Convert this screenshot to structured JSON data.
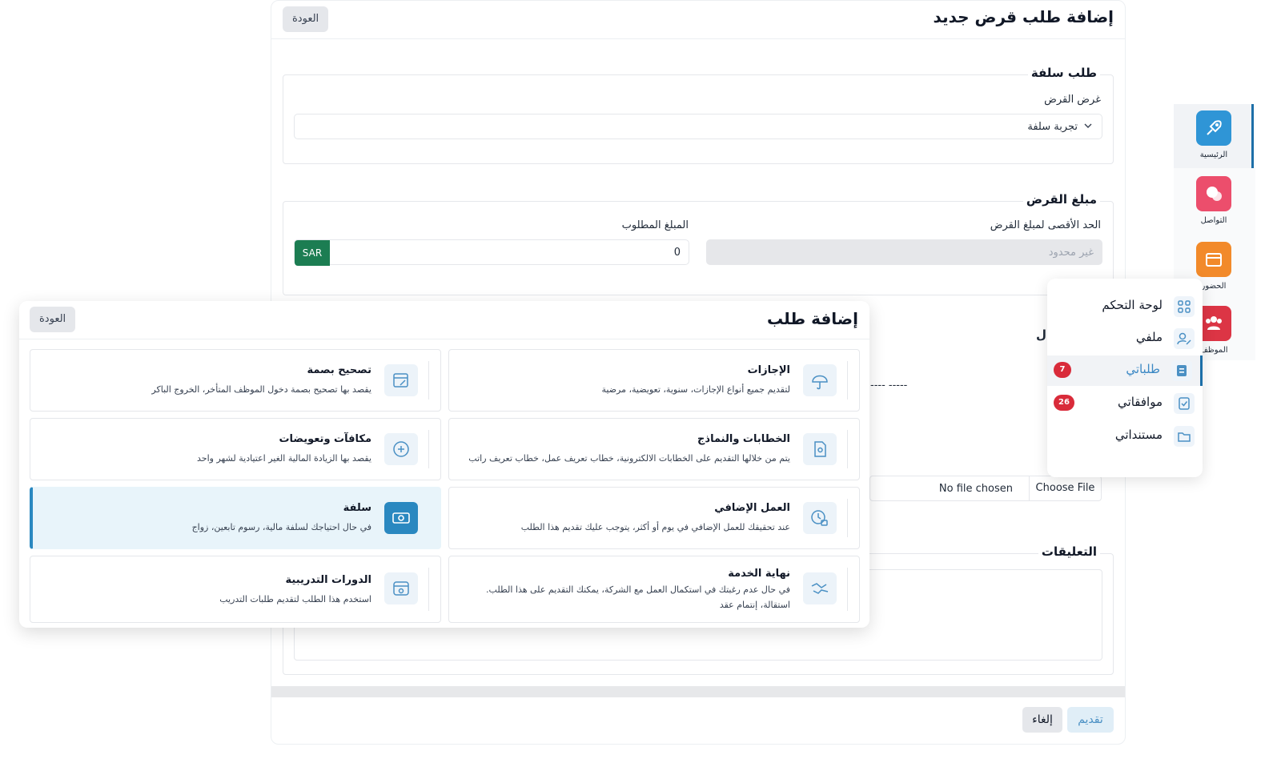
{
  "form": {
    "title": "إضافة طلب قرض جديد",
    "back_label": "العودة",
    "loan_request_legend": "طلب سلفة",
    "purpose_label": "غرض القرض",
    "purpose_value": "تجربة سلفة",
    "amount_legend": "مبلغ القرض",
    "max_amount_label": "الحد الأقصى لمبلغ القرض",
    "max_amount_placeholder": "غير محدود",
    "requested_amount_label": "المبلغ المطلوب",
    "requested_amount_value": "0",
    "currency": "SAR",
    "dashes": "---- -----",
    "partial_legend": "ل",
    "file_name": "No file chosen",
    "choose_file_label": "Choose File",
    "comments_legend": "التعليقات",
    "submit_label": "تقديم",
    "cancel_label": "إلغاء"
  },
  "sidebar": {
    "items": [
      {
        "label": "الرئيسية",
        "icon": "rocket-icon",
        "color": "#2f95d6"
      },
      {
        "label": "التواصل",
        "icon": "chat-icon",
        "color": "#ec4e6c"
      },
      {
        "label": "الحضور",
        "icon": "calendar-icon",
        "color": "#f28a2a"
      },
      {
        "label": "الموظف",
        "icon": "users-icon",
        "color": "#dc3545"
      }
    ]
  },
  "menu": {
    "items": [
      {
        "label": "لوحة التحكم",
        "icon": "grid-icon",
        "badge": ""
      },
      {
        "label": "ملفي",
        "icon": "user-edit-icon",
        "badge": ""
      },
      {
        "label": "طلباتي",
        "icon": "requests-icon",
        "badge": "7"
      },
      {
        "label": "موافقاتي",
        "icon": "approvals-icon",
        "badge": "26"
      },
      {
        "label": "مستنداتي",
        "icon": "folder-icon",
        "badge": ""
      }
    ]
  },
  "modal": {
    "title": "إضافة طلب",
    "back_label": "العودة",
    "cards": [
      {
        "title": "الإجازات",
        "desc": "لتقديم جميع أنواع الإجازات، سنوية، تعويضية، مرضية",
        "icon": "umbrella-icon"
      },
      {
        "title": "تصحيح بصمة",
        "desc": "يقصد بها تصحيح بصمة دخول الموظف المتأخر، الخروج الباكر",
        "icon": "calendar-edit-icon"
      },
      {
        "title": "الخطابات والنماذج",
        "desc": "يتم من خلالها التقديم على الخطابات الالكترونية، خطاب تعريف عمل، خطاب تعريف راتب",
        "icon": "document-icon"
      },
      {
        "title": "مكافآت وتعويضات",
        "desc": "يقصد بها الزيادة المالية الغير اعتيادية لشهر واحد",
        "icon": "plus-circle-icon"
      },
      {
        "title": "العمل الإضافي",
        "desc": "عند تحقيقك للعمل الإضافي في يوم أو أكثر، يتوجب عليك تقديم هذا الطلب",
        "icon": "clock-lock-icon"
      },
      {
        "title": "سلفة",
        "desc": "في حال احتياجك لسلفة مالية، رسوم تابعين، زواج",
        "icon": "money-icon"
      },
      {
        "title": "نهاية الخدمة",
        "desc": "في حال عدم رغبتك في استكمال العمل مع الشركة، يمكنك التقديم على هذا الطلب. استقالة، إنتمام عقد",
        "icon": "handshake-icon"
      },
      {
        "title": "الدورات التدريبية",
        "desc": "استخدم هذا الطلب لتقديم طلبات التدريب",
        "icon": "training-icon"
      }
    ]
  },
  "colors": {
    "accent": "#2a88c0",
    "currency_bg": "#1c7d52",
    "badge": "#d92b3a"
  }
}
